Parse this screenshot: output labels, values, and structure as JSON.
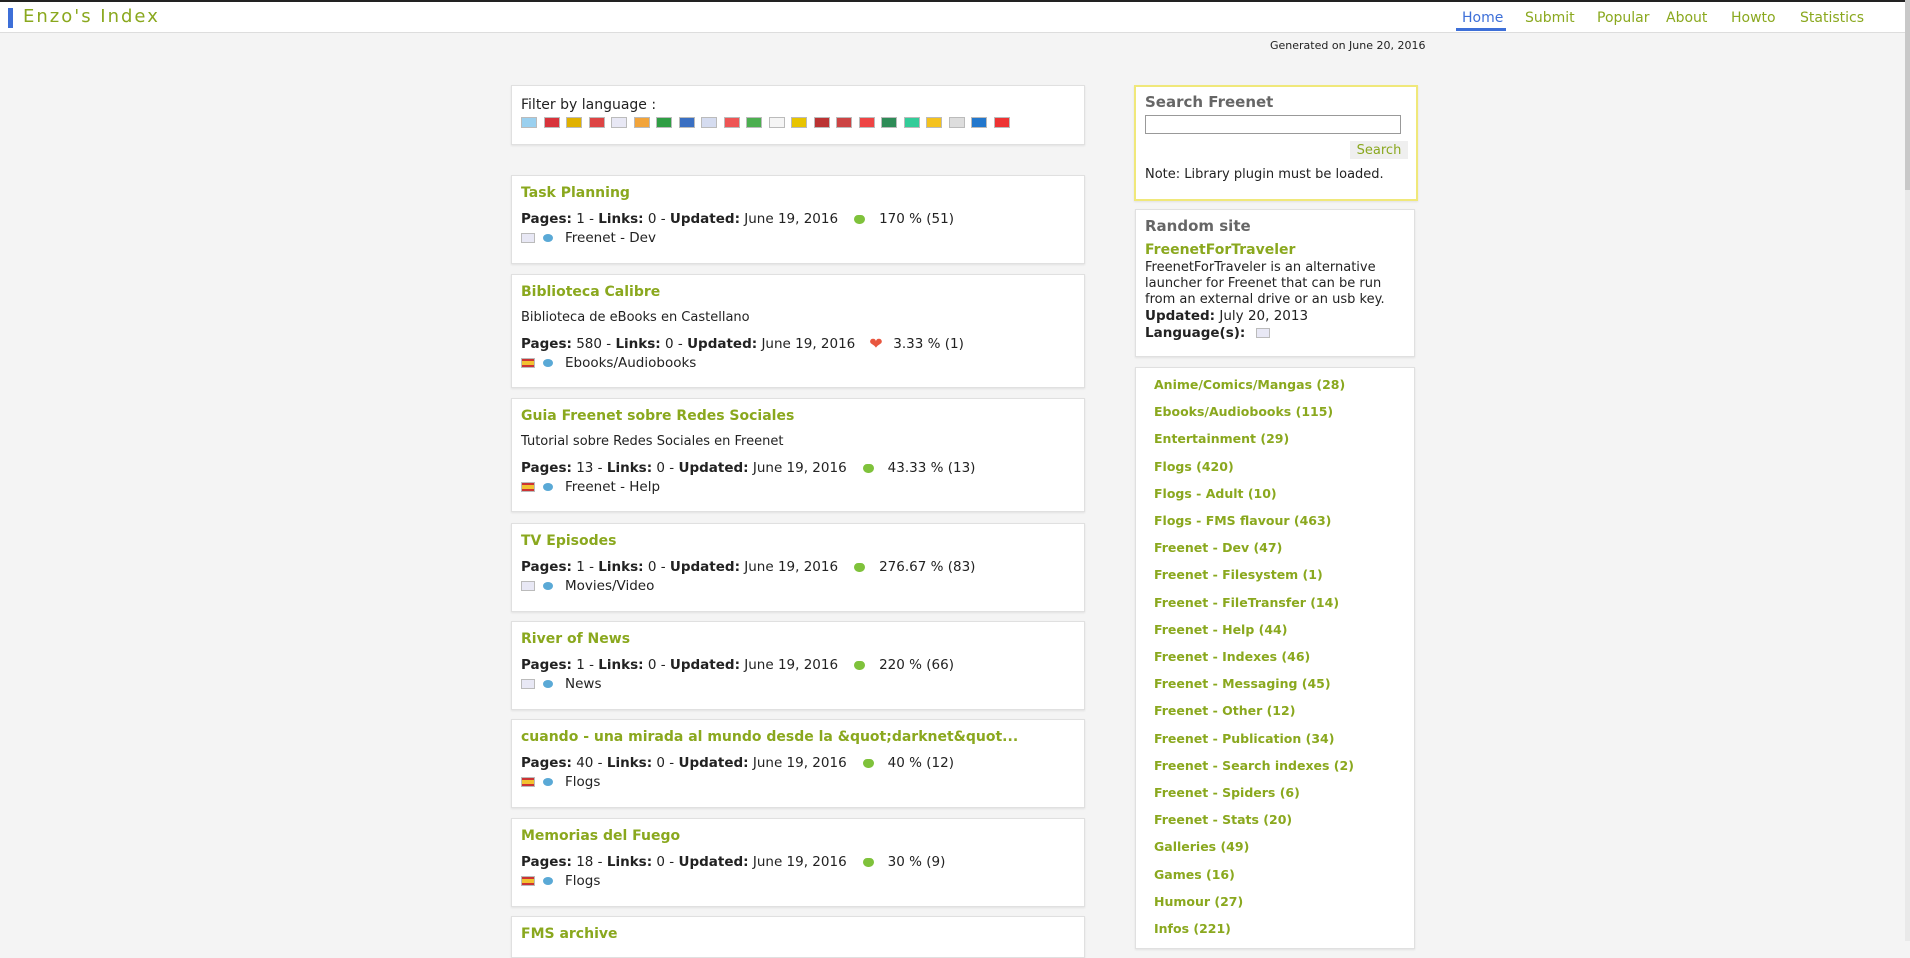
{
  "header": {
    "brand": "Enzo's Index",
    "nav": [
      "Home",
      "Submit",
      "Popular",
      "About",
      "Howto",
      "Statistics"
    ],
    "active": "Home"
  },
  "generated": "Generated on June 20, 2016",
  "filter": {
    "label": "Filter by language :",
    "flags": [
      "argentina-flag-icon",
      "czech-flag-icon",
      "germany-flag-icon",
      "denmark-flag-icon",
      "uk-flag-icon",
      "spain-flag-icon",
      "iran-flag-icon",
      "finland-flag-icon",
      "france-flag-icon",
      "indonesia-flag-icon",
      "italy-flag-icon",
      "japan-flag-icon",
      "lithuania-flag-icon",
      "netherlands-flag-icon",
      "norway-flag-icon",
      "poland-flag-icon",
      "portugal-flag-icon",
      "brazil-flag-icon",
      "romania-flag-icon",
      "russia-flag-icon",
      "slovakia-flag-icon",
      "china-flag-icon"
    ]
  },
  "sites": [
    {
      "title": "Task Planning",
      "desc": "",
      "pages": "1",
      "links": "0",
      "updated": "June 19, 2016",
      "heart": "small",
      "score": "170 % (51)",
      "flag": "uk",
      "category": "Freenet - Dev"
    },
    {
      "title": "Biblioteca Calibre",
      "desc": "Biblioteca de eBooks en Castellano",
      "pages": "580",
      "links": "0",
      "updated": "June 19, 2016",
      "heart": "big",
      "score": "3.33 % (1)",
      "flag": "es",
      "category": "Ebooks/Audiobooks"
    },
    {
      "title": "Guia Freenet sobre Redes Sociales",
      "desc": "Tutorial sobre Redes Sociales en Freenet",
      "pages": "13",
      "links": "0",
      "updated": "June 19, 2016",
      "heart": "small",
      "score": "43.33 % (13)",
      "flag": "es",
      "category": "Freenet - Help"
    },
    {
      "title": "TV Episodes",
      "desc": "",
      "pages": "1",
      "links": "0",
      "updated": "June 19, 2016",
      "heart": "small",
      "score": "276.67 % (83)",
      "flag": "uk",
      "category": "Movies/Video"
    },
    {
      "title": "River of News",
      "desc": "",
      "pages": "1",
      "links": "0",
      "updated": "June 19, 2016",
      "heart": "small",
      "score": "220 % (66)",
      "flag": "uk",
      "category": "News"
    },
    {
      "title": "cuando - una mirada al mundo desde la &quot;darknet&quot...",
      "desc": "",
      "pages": "40",
      "links": "0",
      "updated": "June 19, 2016",
      "heart": "small",
      "score": "40 % (12)",
      "flag": "es",
      "category": "Flogs"
    },
    {
      "title": "Memorias del Fuego",
      "desc": "",
      "pages": "18",
      "links": "0",
      "updated": "June 19, 2016",
      "heart": "small",
      "score": "30 % (9)",
      "flag": "es",
      "category": "Flogs"
    },
    {
      "title": "FMS archive",
      "desc": "",
      "pages": "",
      "links": "",
      "updated": "",
      "heart": "",
      "score": "",
      "flag": "",
      "category": ""
    }
  ],
  "labels": {
    "pages": "Pages:",
    "links": "Links:",
    "updated": "Updated:",
    "sep": " - "
  },
  "search": {
    "title": "Search Freenet",
    "button": "Search",
    "note": "Note: Library plugin must be loaded.",
    "value": ""
  },
  "random": {
    "title": "Random site",
    "site": "FreenetForTraveler",
    "desc": "FreenetForTraveler is an alternative launcher for Freenet that can be run from an external drive or an usb key.",
    "updated_label": "Updated:",
    "updated": "July 20, 2013",
    "lang_label": "Language(s):"
  },
  "categories": [
    "Anime/Comics/Mangas (28)",
    "Ebooks/Audiobooks (115)",
    "Entertainment (29)",
    "Flogs (420)",
    "Flogs - Adult (10)",
    "Flogs - FMS flavour (463)",
    "Freenet - Dev (47)",
    "Freenet - Filesystem (1)",
    "Freenet - FileTransfer (14)",
    "Freenet - Help (44)",
    "Freenet - Indexes (46)",
    "Freenet - Messaging (45)",
    "Freenet - Other (12)",
    "Freenet - Publication (34)",
    "Freenet - Search indexes (2)",
    "Freenet - Spiders (6)",
    "Freenet - Stats (20)",
    "Galleries (49)",
    "Games (16)",
    "Humour (27)",
    "Infos (221)"
  ],
  "colors": {
    "accent": "#8aa81e",
    "active": "#3d6fd8",
    "heart_green": "#7fc23b",
    "heart_red": "#e8563f"
  }
}
